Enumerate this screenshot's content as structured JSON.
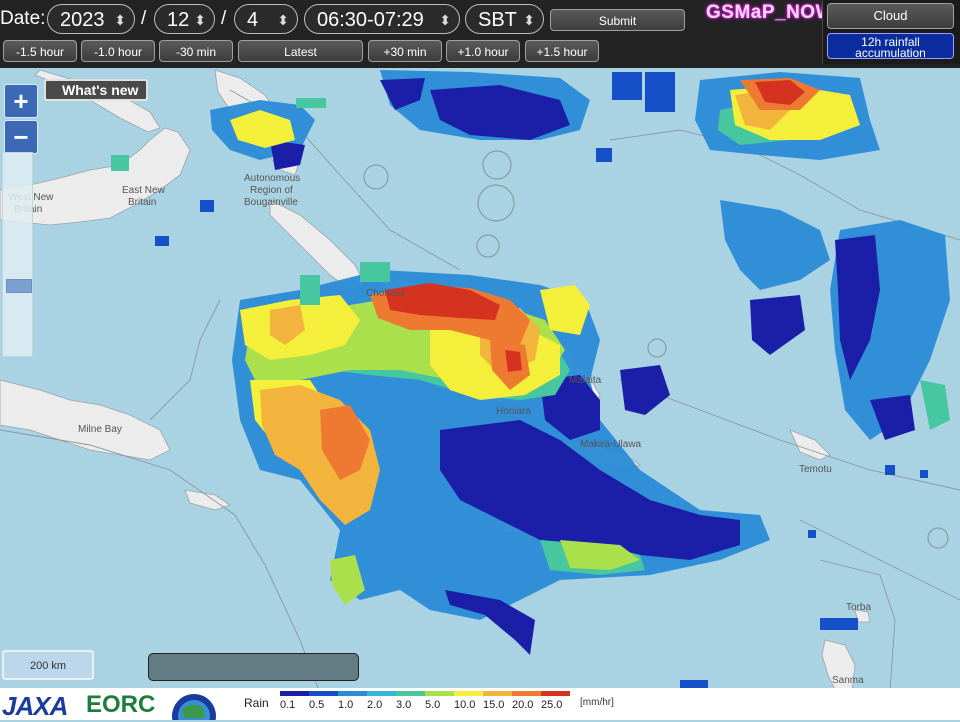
{
  "controls": {
    "date_label": "Date:",
    "year": "2023",
    "sep1": "/",
    "month": "12",
    "sep2": "/",
    "day": "4",
    "time_range": "06:30-07:29",
    "timezone": "SBT",
    "submit": "Submit"
  },
  "time_steps": [
    "-1.5 hour",
    "-1.0 hour",
    "-30 min",
    "Latest",
    "+30 min",
    "+1.0 hour",
    "+1.5 hour"
  ],
  "brand": "GSMaP_NOW",
  "right_buttons": {
    "cloud": "Cloud",
    "accumulation_line1": "12h rainfall",
    "accumulation_line2": "accumulation"
  },
  "map": {
    "zoom_in": "+",
    "zoom_out": "−",
    "whats_new": "What's new",
    "scale": "200 km",
    "zoom_level_fraction": 0.3,
    "places": [
      {
        "name": "West New",
        "name2": "Britain"
      },
      {
        "name": "East New",
        "name2": "Britain"
      },
      {
        "name": "Autonomous",
        "name2": "Region of",
        "name3": "Bougainville"
      },
      {
        "name": "Choiseul"
      },
      {
        "name": "Malaita"
      },
      {
        "name": "Honiara"
      },
      {
        "name": "Makira-Ulawa"
      },
      {
        "name": "Milne Bay"
      },
      {
        "name": "Temotu"
      },
      {
        "name": "Torba"
      },
      {
        "name": "Sanma"
      }
    ]
  },
  "footer": {
    "jaxa": "JAXA",
    "eorc": "EORC",
    "rain_label": "Rain",
    "unit": "[mm/hr]",
    "legend": [
      {
        "value": "0.1",
        "color": "#1b1fa8"
      },
      {
        "value": "0.5",
        "color": "#1550c8"
      },
      {
        "value": "1.0",
        "color": "#2a8bd6"
      },
      {
        "value": "2.0",
        "color": "#33b6d8"
      },
      {
        "value": "3.0",
        "color": "#47c7a0"
      },
      {
        "value": "5.0",
        "color": "#a9e04c"
      },
      {
        "value": "10.0",
        "color": "#f4ef3a"
      },
      {
        "value": "15.0",
        "color": "#f2b43c"
      },
      {
        "value": "20.0",
        "color": "#ee7a32"
      },
      {
        "value": "25.0",
        "color": "#d63220"
      }
    ]
  },
  "colors": {
    "ocean": "#a9d3e3",
    "land": "#ececec",
    "toolbar": "#232323"
  }
}
